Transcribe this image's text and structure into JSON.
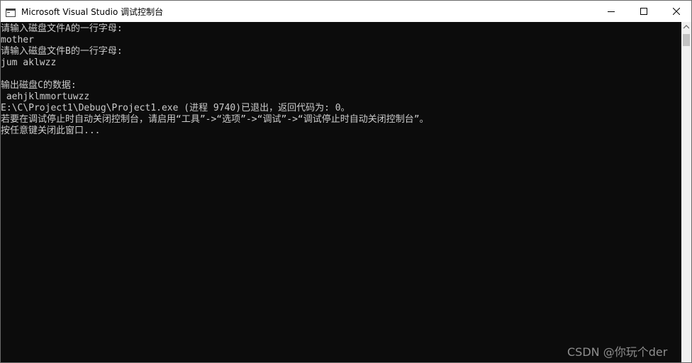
{
  "window": {
    "title": "Microsoft Visual Studio 调试控制台"
  },
  "icons": {
    "app": "console-app-icon",
    "minimize": "minimize-icon",
    "maximize": "maximize-icon",
    "close": "close-icon",
    "scroll_up": "scroll-up-arrow-icon"
  },
  "console": {
    "lines": [
      "请输入磁盘文件A的一行字母:",
      "mother",
      "请输入磁盘文件B的一行字母:",
      "jum aklwzz",
      "",
      "输出磁盘C的数据:",
      " aehjklmmortuwzz",
      "E:\\C\\Project1\\Debug\\Project1.exe (进程 9740)已退出，返回代码为: 0。",
      "若要在调试停止时自动关闭控制台，请启用“工具”->“选项”->“调试”->“调试停止时自动关闭控制台”。",
      "按任意键关闭此窗口..."
    ]
  },
  "watermark": {
    "text": "CSDN @你玩个der"
  },
  "colors": {
    "console_bg": "#0c0c0c",
    "console_text": "#cccccc",
    "titlebar_bg": "#ffffff"
  }
}
